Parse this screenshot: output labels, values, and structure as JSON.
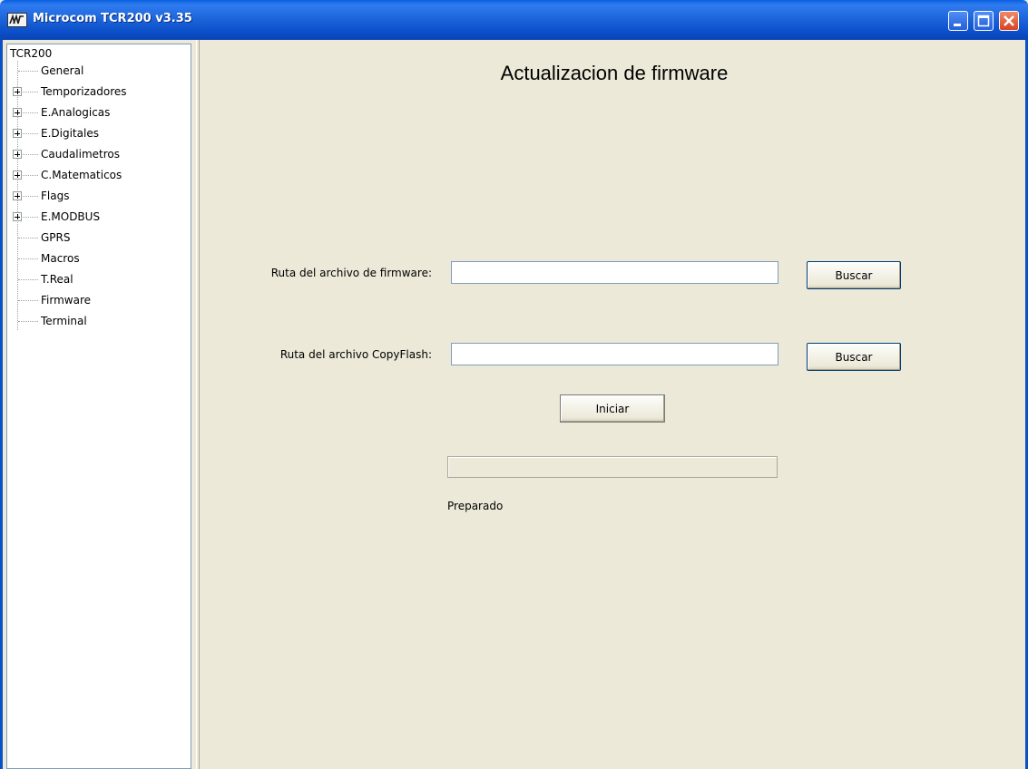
{
  "window": {
    "title": "Microcom TCR200 v3.35",
    "icon": "microcom-logo-icon",
    "controls": [
      "minimize-icon",
      "maximize-icon",
      "close-icon"
    ]
  },
  "tree": {
    "root": "TCR200",
    "items": [
      {
        "label": "General",
        "expandable": false
      },
      {
        "label": "Temporizadores",
        "expandable": true
      },
      {
        "label": "E.Analogicas",
        "expandable": true
      },
      {
        "label": "E.Digitales",
        "expandable": true
      },
      {
        "label": "Caudalimetros",
        "expandable": true
      },
      {
        "label": "C.Matematicos",
        "expandable": true
      },
      {
        "label": "Flags",
        "expandable": true
      },
      {
        "label": "E.MODBUS",
        "expandable": true
      },
      {
        "label": "GPRS",
        "expandable": false
      },
      {
        "label": "Macros",
        "expandable": false
      },
      {
        "label": "T.Real",
        "expandable": false
      },
      {
        "label": "Firmware",
        "expandable": false
      },
      {
        "label": "Terminal",
        "expandable": false
      }
    ]
  },
  "main": {
    "title": "Actualizacion de firmware",
    "firmware": {
      "label": "Ruta del archivo de firmware:",
      "value": "",
      "button": "Buscar"
    },
    "copyflash": {
      "label": "Ruta del archivo CopyFlash:",
      "value": "",
      "button": "Buscar"
    },
    "start_button": "Iniciar",
    "progress_percent": 0,
    "status": "Preparado"
  },
  "colors": {
    "titlebar": "#0a5fe0",
    "window_bg": "#ece9d8",
    "close_button": "#d8431e"
  }
}
